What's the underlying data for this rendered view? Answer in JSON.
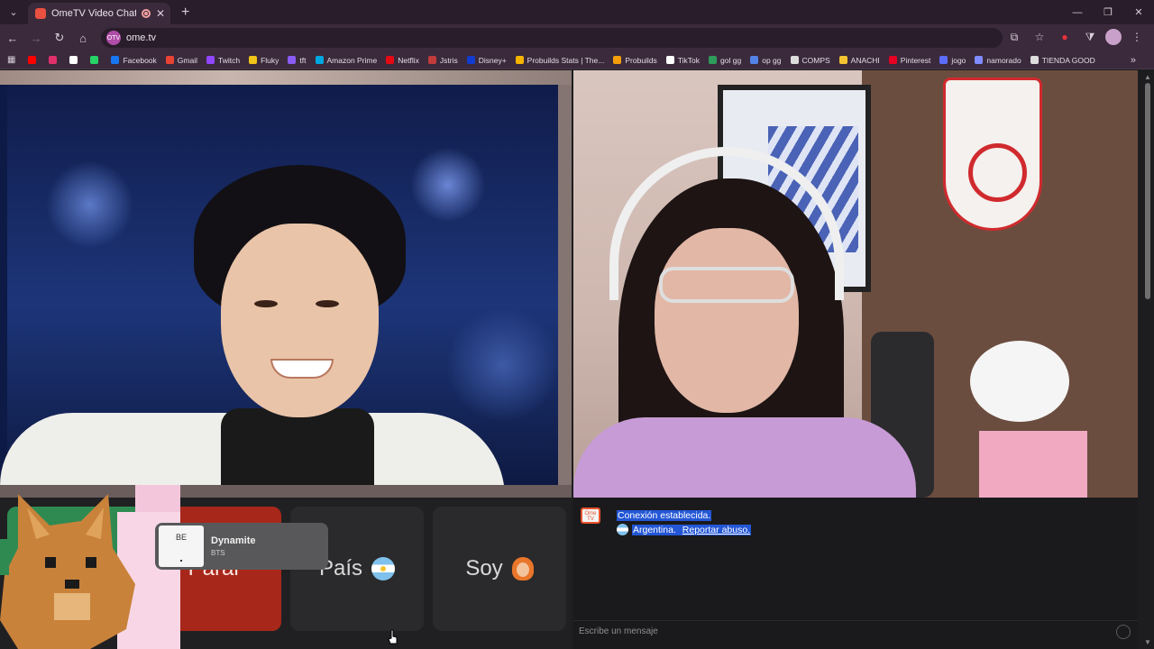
{
  "browser": {
    "tab_title": "OmeTV Video Chat — Ome",
    "url": "ome.tv",
    "site_badge": "OTV",
    "bookmarks": [
      {
        "label": "",
        "icon": "youtube-icon",
        "color": "#ff0000"
      },
      {
        "label": "",
        "icon": "instagram-icon",
        "color": "#e1306c"
      },
      {
        "label": "",
        "icon": "x-icon",
        "color": "#ffffff"
      },
      {
        "label": "",
        "icon": "whatsapp-icon",
        "color": "#25d366"
      },
      {
        "label": "Facebook",
        "icon": "facebook-icon",
        "color": "#1877f2"
      },
      {
        "label": "Gmail",
        "icon": "gmail-icon",
        "color": "#ea4335"
      },
      {
        "label": "Twitch",
        "icon": "twitch-icon",
        "color": "#9146ff"
      },
      {
        "label": "Fluky",
        "icon": "fluky-icon",
        "color": "#f0c419"
      },
      {
        "label": "tft",
        "icon": "tft-icon",
        "color": "#8a5cf6"
      },
      {
        "label": "Amazon Prime",
        "icon": "prime-icon",
        "color": "#00a8e1"
      },
      {
        "label": "Netflix",
        "icon": "netflix-icon",
        "color": "#e50914"
      },
      {
        "label": "Jstris",
        "icon": "jstris-icon",
        "color": "#c23b3b"
      },
      {
        "label": "Disney+",
        "icon": "disney-icon",
        "color": "#113ccf"
      },
      {
        "label": "Probuilds Stats | The...",
        "icon": "probuilds-stats-icon",
        "color": "#f5b400"
      },
      {
        "label": "Probuilds",
        "icon": "probuilds-icon",
        "color": "#f59e0b"
      },
      {
        "label": "TikTok",
        "icon": "tiktok-icon",
        "color": "#ffffff"
      },
      {
        "label": "gol gg",
        "icon": "golgg-icon",
        "color": "#2e9c5a"
      },
      {
        "label": "op gg",
        "icon": "opgg-icon",
        "color": "#5383e8"
      },
      {
        "label": "COMPS",
        "icon": "comps-icon",
        "color": "#dddddd"
      },
      {
        "label": "ANACHI",
        "icon": "crown-icon",
        "color": "#f4c430"
      },
      {
        "label": "Pinterest",
        "icon": "pinterest-icon",
        "color": "#e60023"
      },
      {
        "label": "jogo",
        "icon": "jogo-icon",
        "color": "#5b6cff"
      },
      {
        "label": "namorado",
        "icon": "namorado-icon",
        "color": "#7f8cff"
      },
      {
        "label": "TIENDA GOOD",
        "icon": "store-icon",
        "color": "#dddddd"
      }
    ]
  },
  "controls": {
    "stop_label": "Parar",
    "country_label": "País",
    "country_flag": "argentina-flag-icon",
    "gender_label": "Soy",
    "gender_emoji": "woman-emoji-icon"
  },
  "media": {
    "art_text": "BE",
    "song": "Dynamite",
    "artist": "BTS"
  },
  "chat": {
    "status": "Conexión establecida.",
    "country": "Argentina.",
    "report_link": "Reportar abuso.",
    "input_placeholder": "Escribe un mensaje",
    "logo_text": "Ome TV"
  },
  "colors": {
    "stop_button": "#a8271b",
    "chat_highlight": "#2457d6",
    "brand": "#e8532e"
  }
}
